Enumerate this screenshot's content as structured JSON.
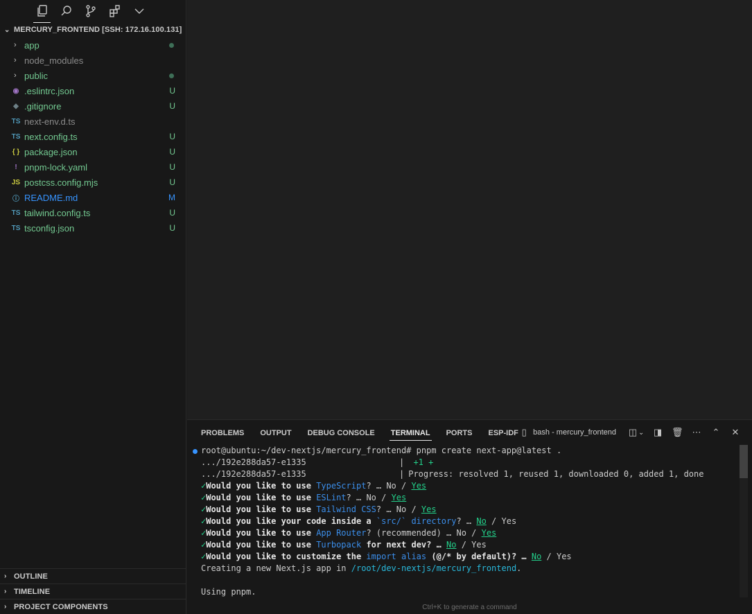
{
  "explorer": {
    "title": "MERCURY_FRONTEND [SSH: 172.16.100.131]",
    "items": [
      {
        "type": "folder",
        "name": "app",
        "icon": "chevron-right-icon",
        "color": "green",
        "decoration": "dot"
      },
      {
        "type": "folder",
        "name": "node_modules",
        "icon": "chevron-right-icon",
        "color": "dim",
        "decoration": ""
      },
      {
        "type": "folder",
        "name": "public",
        "icon": "chevron-right-icon",
        "color": "green",
        "decoration": "dot"
      },
      {
        "type": "file",
        "name": ".eslintrc.json",
        "icon_glyph": "◉",
        "icon_color": "#a074c4",
        "color": "green",
        "decoration": "U"
      },
      {
        "type": "file",
        "name": ".gitignore",
        "icon_glyph": "◆",
        "icon_color": "#6d8086",
        "color": "green",
        "decoration": "U"
      },
      {
        "type": "file",
        "name": "next-env.d.ts",
        "icon_glyph": "TS",
        "icon_color": "#519aba",
        "color": "dim",
        "decoration": ""
      },
      {
        "type": "file",
        "name": "next.config.ts",
        "icon_glyph": "TS",
        "icon_color": "#519aba",
        "color": "green",
        "decoration": "U"
      },
      {
        "type": "file",
        "name": "package.json",
        "icon_glyph": "{ }",
        "icon_color": "#cbcb41",
        "color": "green",
        "decoration": "U"
      },
      {
        "type": "file",
        "name": "pnpm-lock.yaml",
        "icon_glyph": "!",
        "icon_color": "#a074c4",
        "color": "green",
        "decoration": "U"
      },
      {
        "type": "file",
        "name": "postcss.config.mjs",
        "icon_glyph": "JS",
        "icon_color": "#cbcb41",
        "color": "green",
        "decoration": "U"
      },
      {
        "type": "file",
        "name": "README.md",
        "icon_glyph": "ⓘ",
        "icon_color": "#519aba",
        "color": "blue",
        "decoration": "M"
      },
      {
        "type": "file",
        "name": "tailwind.config.ts",
        "icon_glyph": "TS",
        "icon_color": "#519aba",
        "color": "green",
        "decoration": "U"
      },
      {
        "type": "file",
        "name": "tsconfig.json",
        "icon_glyph": "TS",
        "icon_color": "#519aba",
        "color": "green",
        "decoration": "U"
      }
    ]
  },
  "bottom_sections": [
    "OUTLINE",
    "TIMELINE",
    "PROJECT COMPONENTS"
  ],
  "panel": {
    "tabs": [
      "PROBLEMS",
      "OUTPUT",
      "DEBUG CONSOLE",
      "TERMINAL",
      "PORTS",
      "ESP-IDF"
    ],
    "active_tab": "TERMINAL",
    "terminal_name": "bash - mercury_frontend",
    "hint": "Ctrl+K to generate a command"
  },
  "terminal": {
    "prompt": "root@ubuntu:~/dev-nextjs/mercury_frontend#",
    "command": " pnpm create next-app@latest .",
    "line2_left": ".../192e288da57-e1335",
    "line2_right": "  +1 +",
    "line3_left": ".../192e288da57-e1335",
    "line3_right": " Progress: resolved 1, reused 1, downloaded 0, added 1, done",
    "q1": {
      "pre": "Would you like to use ",
      "hl": "TypeScript",
      "post": "? … No / ",
      "ans": "Yes"
    },
    "q2": {
      "pre": "Would you like to use ",
      "hl": "ESLint",
      "post": "? … No / ",
      "ans": "Yes"
    },
    "q3": {
      "pre": "Would you like to use ",
      "hl": "Tailwind CSS",
      "post": "? … No / ",
      "ans": "Yes"
    },
    "q4": {
      "pre": "Would you like your code inside a ",
      "hl": "`src/` directory",
      "post": "? … ",
      "ans": "No",
      "tail": " / Yes"
    },
    "q5": {
      "pre": "Would you like to use ",
      "hl": "App Router",
      "post": "? (recommended) … No / ",
      "ans": "Yes"
    },
    "q6": {
      "pre": "Would you like to use ",
      "hl": "Turbopack",
      "post": " for next dev? … ",
      "ans": "No",
      "tail": " / Yes"
    },
    "q7": {
      "pre": "Would you like to customize the ",
      "hl": "import alias",
      "mid": " (@/* by default)? … ",
      "ans": "No",
      "tail": " / Yes"
    },
    "creating_pre": "Creating a new Next.js app in ",
    "creating_path": "/root/dev-nextjs/mercury_frontend",
    "creating_post": ".",
    "using": "Using pnpm."
  }
}
